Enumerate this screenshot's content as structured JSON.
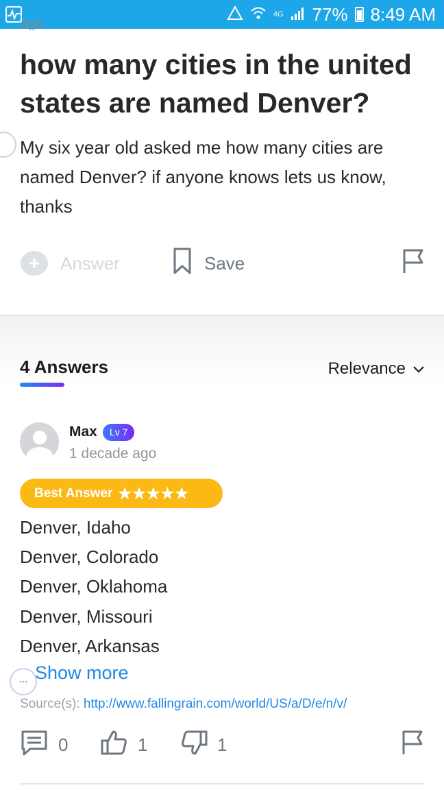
{
  "status_bar": {
    "battery": "77%",
    "time": "8:49 AM",
    "network_label": "4G"
  },
  "question": {
    "cut_text": "ago",
    "title": "how many cities in the united states are named Denver?",
    "body": "My six year old asked me how many cities are named Denver? if anyone knows lets us know, thanks",
    "actions": {
      "answer": "Answer",
      "save": "Save"
    }
  },
  "answers_header": {
    "count_label": "4 Answers",
    "sort": "Relevance"
  },
  "answer": {
    "user": "Max",
    "level": "Lv 7",
    "time": "1 decade ago",
    "best_label": "Best Answer",
    "stars": "★★★★★",
    "lines": [
      "Denver, Idaho",
      "Denver, Colorado",
      "Denver, Oklahoma",
      "Denver, Missouri",
      "Denver, Arkansas"
    ],
    "show_more": "Show more",
    "more_glyph": "...",
    "source_label": "Source(s):",
    "source_url": "http://www.fallingrain.com/world/US/a/D/e/n/v/",
    "comments": "0",
    "upvotes": "1",
    "downvotes": "1"
  },
  "colors": {
    "status_bar": "#1ea7e8",
    "best_answer": "#fdb913",
    "link": "#1e88e5",
    "level_badge_start": "#3a7bf7",
    "level_badge_end": "#7b2cf5"
  },
  "icons": [
    "activity-icon",
    "recycle-icon",
    "wifi-icon",
    "signal-icon",
    "battery-icon",
    "answer-bubble-icon",
    "bookmark-icon",
    "flag-icon",
    "comment-icon",
    "thumbs-up-icon",
    "thumbs-down-icon",
    "chevron-down-icon"
  ]
}
